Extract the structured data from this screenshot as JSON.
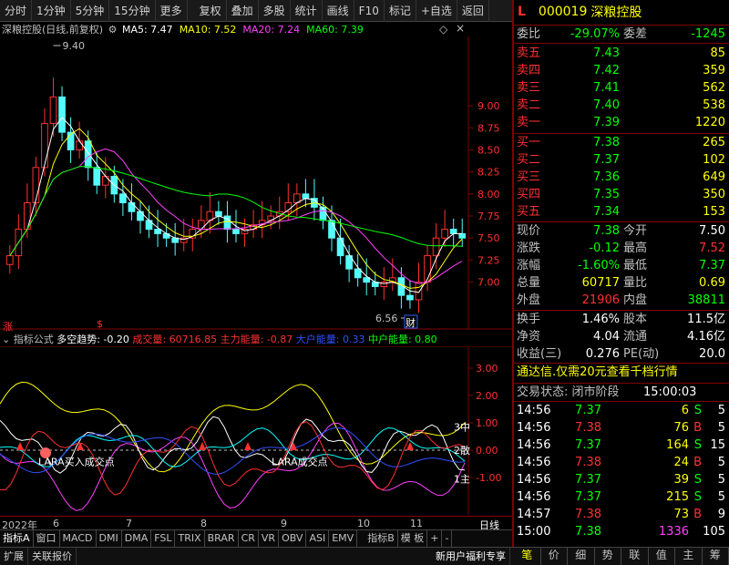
{
  "toolbar": {
    "items": [
      "分时",
      "1分钟",
      "5分钟",
      "15分钟",
      "更多",
      "复权",
      "叠加",
      "多股",
      "统计",
      "画线",
      "F10",
      "标记",
      "+自选",
      "返回"
    ]
  },
  "chart_header": {
    "title": "深粮控股(日线,前复权)",
    "ma5": "MA5: 7.47",
    "ma10": "MA10: 7.52",
    "ma20": "MA20: 7.24",
    "ma60": "MA60: 7.39",
    "high_label": "9.40",
    "low_label": "6.56",
    "cai_mark": "财",
    "zhang_mark": "涨",
    "dollar_mark": "$"
  },
  "chart_data": [
    {
      "type": "candlestick",
      "y_ticks": [
        "9.00",
        "8.75",
        "8.50",
        "8.25",
        "8.00",
        "7.75",
        "7.50",
        "7.25",
        "7.00"
      ],
      "ylim": [
        6.5,
        9.6
      ],
      "close": [
        7.3,
        7.6,
        7.9,
        8.3,
        8.8,
        9.1,
        8.7,
        8.5,
        8.6,
        8.3,
        8.1,
        8.2,
        8.0,
        7.9,
        7.8,
        7.7,
        7.6,
        7.55,
        7.5,
        7.45,
        7.5,
        7.6,
        7.7,
        7.8,
        7.75,
        7.6,
        7.55,
        7.6,
        7.65,
        7.7,
        7.75,
        7.8,
        7.9,
        8.0,
        7.95,
        7.85,
        7.7,
        7.5,
        7.3,
        7.15,
        7.05,
        7.0,
        6.95,
        7.0,
        7.05,
        6.85,
        6.8,
        7.0,
        7.3,
        7.5,
        7.6,
        7.55,
        7.5
      ]
    },
    {
      "type": "line",
      "title": "多空趋势: -0.20",
      "series": [
        {
          "name": "成交量: 60716.85",
          "color": "#ff3030"
        },
        {
          "name": "主力能量: -0.87",
          "color": "#ff3030"
        },
        {
          "name": "大户能量: 0.33",
          "color": "#3050ff"
        },
        {
          "name": "中户能量: 0.80",
          "color": "#00ff00"
        }
      ],
      "y_ticks": [
        "3.00",
        "2.00",
        "1.00",
        "0.00",
        "-1.00"
      ],
      "ylim": [
        -2.2,
        3.6
      ]
    }
  ],
  "indicator": {
    "prefix": "指标公式",
    "trend": "多空趋势: -0.20",
    "vol": "成交量: 60716.85",
    "main_energy": "主力能量: -0.87",
    "big_energy": "大户能量: 0.33",
    "mid_energy": "中户能量: 0.80",
    "annot1": "LARA买入成交点",
    "annot2": "LARA成交点",
    "r_labels": [
      "3中",
      "2散",
      "1主"
    ]
  },
  "dates": [
    "2022年",
    "6",
    "7",
    "8",
    "9",
    "10",
    "11",
    "日线"
  ],
  "bottom_tabs": [
    "指标A",
    "窗口",
    "MACD",
    "DMI",
    "DMA",
    "FSL",
    "TRIX",
    "BRAR",
    "CR",
    "VR",
    "OBV",
    "ASI",
    "EMV",
    "指标B",
    "模 板",
    "+",
    "-"
  ],
  "status_bar": {
    "left": [
      "扩展",
      "关联报价"
    ],
    "right": "新用户福利专享"
  },
  "quote": {
    "l_mark": "L",
    "code": "000019",
    "name": "深粮控股",
    "weibi_label": "委比",
    "weibi": "-29.07%",
    "weicha_label": "委差",
    "weicha": "-1245",
    "sell": [
      {
        "label": "卖五",
        "price": "7.43",
        "vol": "85"
      },
      {
        "label": "卖四",
        "price": "7.42",
        "vol": "359"
      },
      {
        "label": "卖三",
        "price": "7.41",
        "vol": "562"
      },
      {
        "label": "卖二",
        "price": "7.40",
        "vol": "538"
      },
      {
        "label": "卖一",
        "price": "7.39",
        "vol": "1220"
      }
    ],
    "buy": [
      {
        "label": "买一",
        "price": "7.38",
        "vol": "265"
      },
      {
        "label": "买二",
        "price": "7.37",
        "vol": "102"
      },
      {
        "label": "买三",
        "price": "7.36",
        "vol": "649"
      },
      {
        "label": "买四",
        "price": "7.35",
        "vol": "350"
      },
      {
        "label": "买五",
        "price": "7.34",
        "vol": "153"
      }
    ],
    "stats": [
      {
        "l1": "现价",
        "v1": "7.38",
        "c1": "g",
        "l2": "今开",
        "v2": "7.50",
        "c2": "w"
      },
      {
        "l1": "涨跌",
        "v1": "-0.12",
        "c1": "g",
        "l2": "最高",
        "v2": "7.52",
        "c2": "r"
      },
      {
        "l1": "涨幅",
        "v1": "-1.60%",
        "c1": "g",
        "l2": "最低",
        "v2": "7.37",
        "c2": "g"
      },
      {
        "l1": "总量",
        "v1": "60717",
        "c1": "y",
        "l2": "量比",
        "v2": "0.69",
        "c2": "y"
      },
      {
        "l1": "外盘",
        "v1": "21906",
        "c1": "r",
        "l2": "内盘",
        "v2": "38811",
        "c2": "g"
      }
    ],
    "stats2": [
      {
        "l1": "换手",
        "v1": "1.46%",
        "l2": "股本",
        "v2": "11.5亿"
      },
      {
        "l1": "净资",
        "v1": "4.04",
        "l2": "流通",
        "v2": "4.16亿"
      },
      {
        "l1": "收益(三)",
        "v1": "0.276",
        "l2": "PE(动)",
        "v2": "20.0"
      }
    ],
    "ad": "通达信.仅需20元查看千档行情",
    "trade_state_label": "交易状态: 闭市阶段",
    "trade_state_time": "15:00:03",
    "ticks": [
      {
        "t": "14:56",
        "p": "7.37",
        "v": "6",
        "s": "S",
        "n": "5"
      },
      {
        "t": "14:56",
        "p": "7.38",
        "v": "76",
        "s": "B",
        "n": "5"
      },
      {
        "t": "14:56",
        "p": "7.37",
        "v": "164",
        "s": "S",
        "n": "15"
      },
      {
        "t": "14:56",
        "p": "7.38",
        "v": "24",
        "s": "B",
        "n": "5"
      },
      {
        "t": "14:56",
        "p": "7.37",
        "v": "39",
        "s": "S",
        "n": "5"
      },
      {
        "t": "14:56",
        "p": "7.37",
        "v": "215",
        "s": "S",
        "n": "5"
      },
      {
        "t": "14:57",
        "p": "7.38",
        "v": "73",
        "s": "B",
        "n": "9"
      },
      {
        "t": "15:00",
        "p": "7.38",
        "v": "1336",
        "s": "",
        "n": "105"
      }
    ],
    "bottom_tabs": [
      "笔",
      "价",
      "细",
      "势",
      "联",
      "值",
      "主",
      "筹"
    ]
  }
}
